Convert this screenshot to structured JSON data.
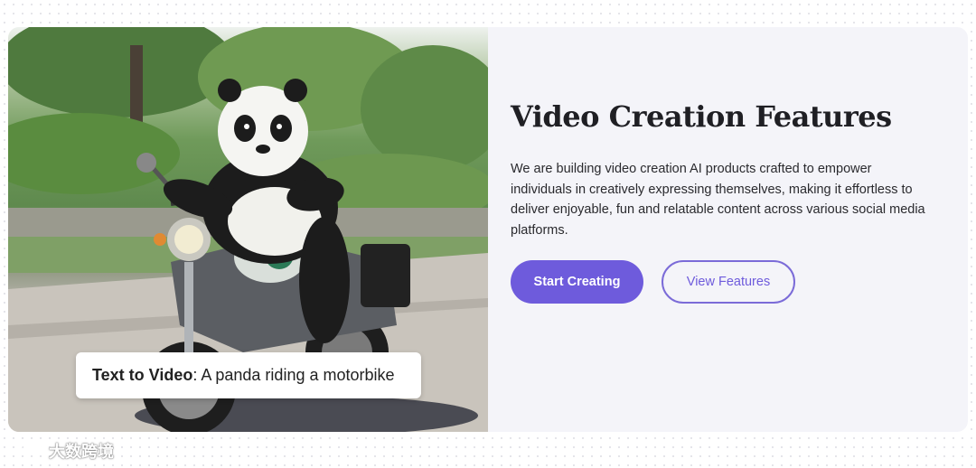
{
  "media": {
    "caption_bold": "Text to Video",
    "caption_rest": ": A panda riding a motorbike"
  },
  "feature": {
    "title": "Video Creation Features",
    "description": "We are building video creation AI products crafted to empower individuals in creatively expressing themselves, making it effortless to deliver enjoyable, fun and relatable content across various social media platforms."
  },
  "buttons": {
    "primary_label": "Start Creating",
    "secondary_label": "View Features"
  },
  "watermark": {
    "text": "大数跨境",
    "icon": "logo-icon"
  },
  "colors": {
    "accent": "#6e5bdc",
    "card_bg": "#f4f4f9",
    "title": "#1f1f24"
  }
}
